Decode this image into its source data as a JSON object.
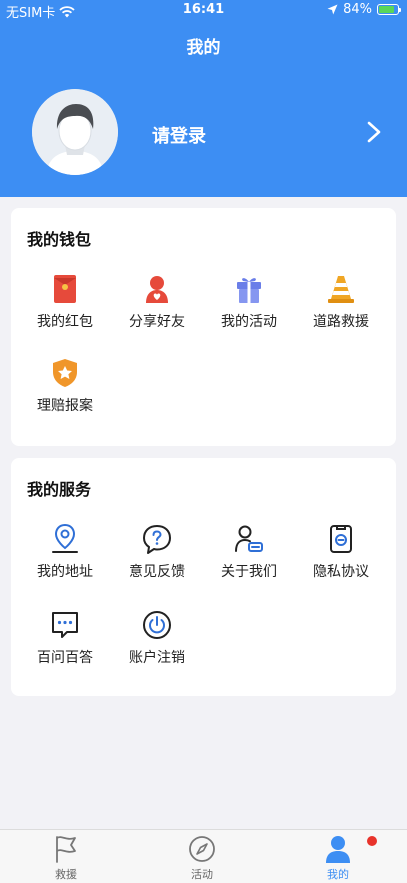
{
  "status_bar": {
    "carrier": "无SIM卡",
    "time": "16:41",
    "battery": "84%",
    "battery_level": 0.84
  },
  "header": {
    "title": "我的",
    "login_text": "请登录"
  },
  "wallet": {
    "title": "我的钱包",
    "items": [
      {
        "label": "我的红包",
        "icon": "red-envelope-icon"
      },
      {
        "label": "分享好友",
        "icon": "share-friend-icon"
      },
      {
        "label": "我的活动",
        "icon": "gift-icon"
      },
      {
        "label": "道路救援",
        "icon": "traffic-cone-icon"
      },
      {
        "label": "理赔报案",
        "icon": "claim-shield-icon"
      }
    ]
  },
  "service": {
    "title": "我的服务",
    "items": [
      {
        "label": "我的地址",
        "icon": "location-icon"
      },
      {
        "label": "意见反馈",
        "icon": "feedback-question-icon"
      },
      {
        "label": "关于我们",
        "icon": "about-user-icon"
      },
      {
        "label": "隐私协议",
        "icon": "privacy-icon"
      },
      {
        "label": "百问百答",
        "icon": "qa-chat-icon"
      },
      {
        "label": "账户注销",
        "icon": "power-icon"
      }
    ]
  },
  "tabbar": {
    "items": [
      {
        "label": "救援",
        "icon": "flag-icon"
      },
      {
        "label": "活动",
        "icon": "compass-icon"
      },
      {
        "label": "我的",
        "icon": "person-icon"
      }
    ],
    "active": "我的"
  },
  "colors": {
    "primary": "#3d8ef3",
    "badge": "#e8332b",
    "background": "#f2f2f6"
  }
}
